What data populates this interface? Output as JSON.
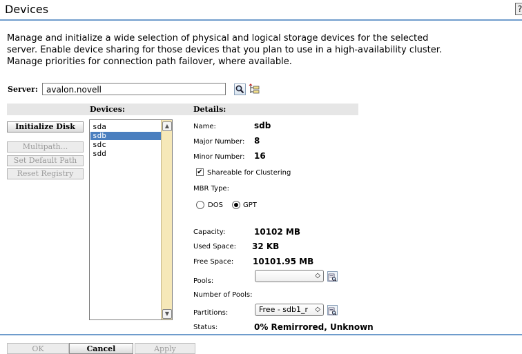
{
  "page": {
    "title": "Devices",
    "help_label": "?",
    "description": [
      "Manage and initialize a wide selection of physical and logical storage devices for the selected",
      "server. Enable device sharing for those devices that you plan to use in a high-availability cluster.",
      "Manage priorities for connection path failover, where available."
    ]
  },
  "server": {
    "label": "Server:",
    "value": "avalon.novell"
  },
  "headers": {
    "devices": "Devices:",
    "details": "Details:"
  },
  "actions": {
    "initialize_disk": "Initialize Disk",
    "multipath": "Multipath...",
    "set_default_path": "Set Default Path",
    "reset_registry": "Reset Registry"
  },
  "devices": {
    "items": [
      "sda",
      "sdb",
      "sdc",
      "sdd"
    ],
    "selected": "sdb"
  },
  "details": {
    "name_label": "Name:",
    "name_value": "sdb",
    "major_label": "Major Number:",
    "major_value": "8",
    "minor_label": "Minor Number:",
    "minor_value": "16",
    "shareable_label": "Shareable for Clustering",
    "shareable_checked": true,
    "mbr_label": "MBR Type:",
    "mbr_dos": "DOS",
    "mbr_gpt": "GPT",
    "mbr_selected": "GPT",
    "capacity_label": "Capacity:",
    "capacity_value": "10102 MB",
    "used_label": "Used Space:",
    "used_value": "32 KB",
    "free_label": "Free Space:",
    "free_value": "10101.95 MB",
    "pools_label": "Pools:",
    "pools_value": "",
    "num_pools_label": "Number of Pools:",
    "partitions_label": "Partitions:",
    "partitions_value": "Free - sdb1_r",
    "status_label": "Status:",
    "status_value": "0% Remirrored, Unknown"
  },
  "footer": {
    "ok": "OK",
    "cancel": "Cancel",
    "apply": "Apply"
  },
  "colors": {
    "rule": "#6f9ccc",
    "selection": "#4a7fbf",
    "scrollbar": "#f6e8b8"
  }
}
